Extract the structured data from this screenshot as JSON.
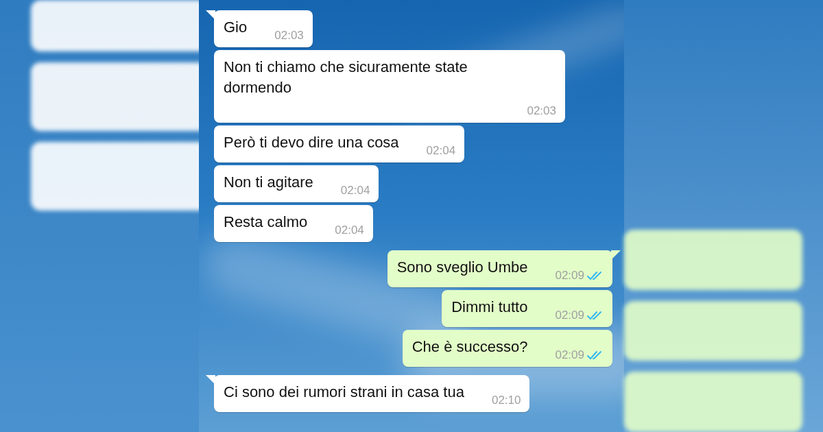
{
  "messages": [
    {
      "kind": "in",
      "tail": true,
      "text": "Gio",
      "time": "02:03"
    },
    {
      "kind": "in",
      "tail": false,
      "text": "Non ti chiamo che sicuramente state dormendo",
      "time": "02:03"
    },
    {
      "kind": "in",
      "tail": false,
      "text": "Però ti devo dire una cosa",
      "time": "02:04"
    },
    {
      "kind": "in",
      "tail": false,
      "text": "Non ti agitare",
      "time": "02:04"
    },
    {
      "kind": "in",
      "tail": false,
      "text": "Resta calmo",
      "time": "02:04"
    },
    {
      "kind": "out",
      "tail": true,
      "text": "Sono sveglio Umbe",
      "time": "02:09",
      "read": true
    },
    {
      "kind": "out",
      "tail": false,
      "text": "Dimmi tutto",
      "time": "02:09",
      "read": true
    },
    {
      "kind": "out",
      "tail": false,
      "text": "Che è successo?",
      "time": "02:09",
      "read": true
    },
    {
      "kind": "in",
      "tail": true,
      "text": "Ci sono dei rumori strani in casa tua",
      "time": "02:10"
    }
  ]
}
